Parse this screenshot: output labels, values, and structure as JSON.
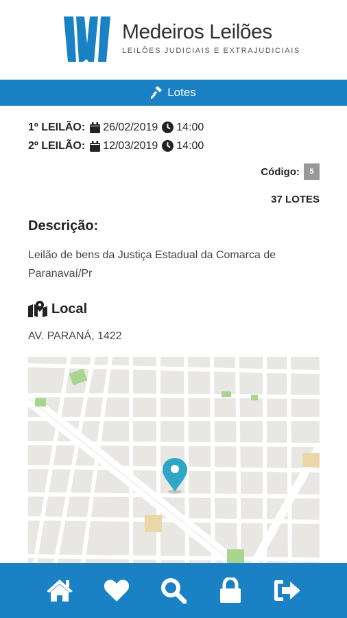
{
  "brand": {
    "name": "Medeiros Leilões",
    "tagline": "LEILÕES JUDICIAIS E EXTRAJUDICIAIS",
    "color": "#1a82c4"
  },
  "section_bar": {
    "label": "Lotes",
    "icon": "gavel-icon"
  },
  "auctions": [
    {
      "label": "1º LEILÃO:",
      "date": "26/02/2019",
      "time": "14:00"
    },
    {
      "label": "2º LEILÃO:",
      "date": "12/03/2019",
      "time": "14:00"
    }
  ],
  "codigo": {
    "label": "Código:",
    "value": "5"
  },
  "lotes_count": "37 LOTES",
  "descricao": {
    "title": "Descrição:",
    "text": "Leilão de bens da Justiça Estadual da Comarca de Paranavaí/Pr"
  },
  "local": {
    "title": "Local",
    "address": "AV. PARANÁ, 1422",
    "icon": "map-marked-icon"
  },
  "bottom_nav": [
    {
      "icon": "home-icon"
    },
    {
      "icon": "heart-icon"
    },
    {
      "icon": "search-icon"
    },
    {
      "icon": "lock-icon"
    },
    {
      "icon": "sign-out-icon"
    }
  ]
}
